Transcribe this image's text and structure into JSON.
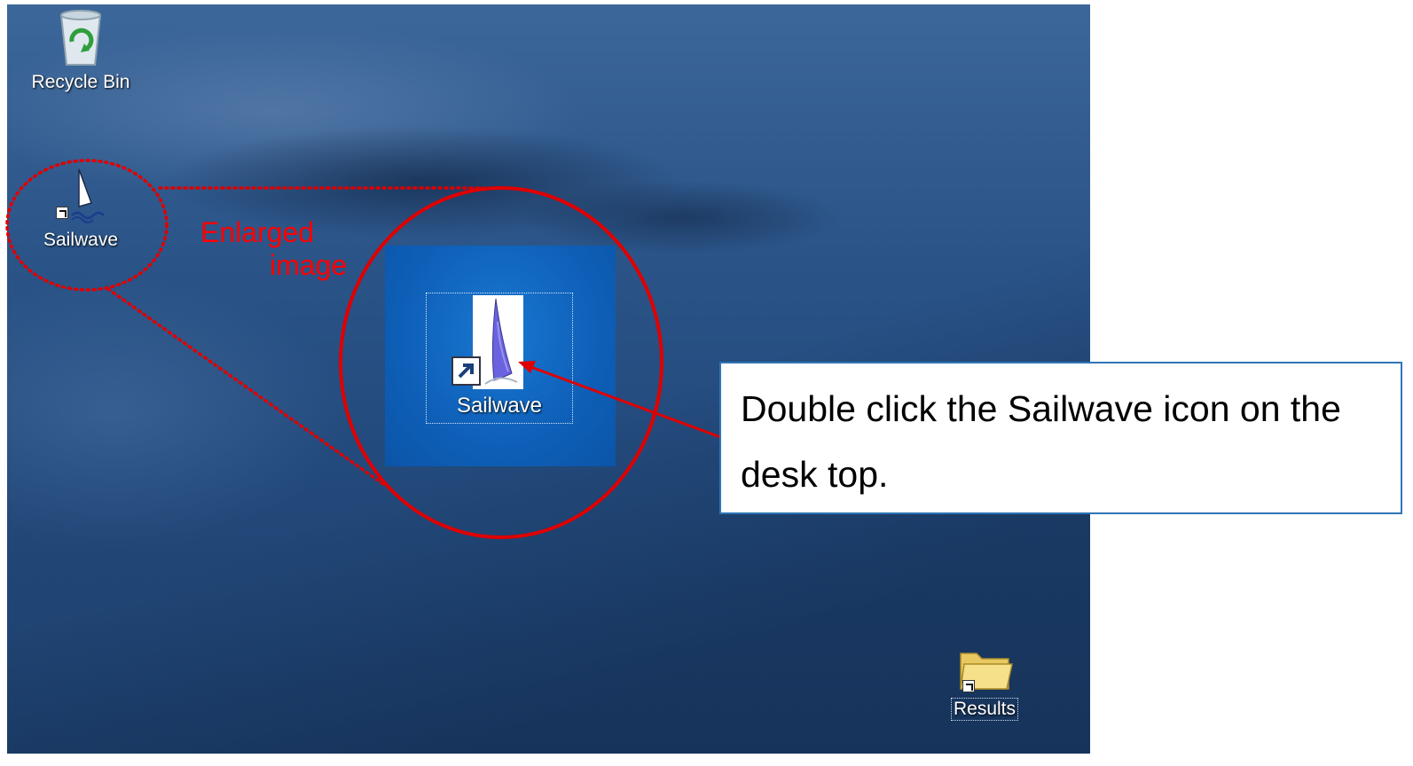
{
  "desktop": {
    "icons": [
      {
        "label": "Recycle Bin",
        "icon": "recycle-bin-icon"
      },
      {
        "label": "Sailwave",
        "icon": "sailwave-icon"
      },
      {
        "label": "Results",
        "icon": "folder-icon"
      }
    ]
  },
  "annotation": {
    "enlarged_line1": "Enlarged",
    "enlarged_line2": "image",
    "zoom_label": "Sailwave",
    "callout_text": "Double click the Sailwave icon on the desk top.",
    "accent_color": "#ff0000",
    "callout_border_color": "#2e75b6"
  }
}
